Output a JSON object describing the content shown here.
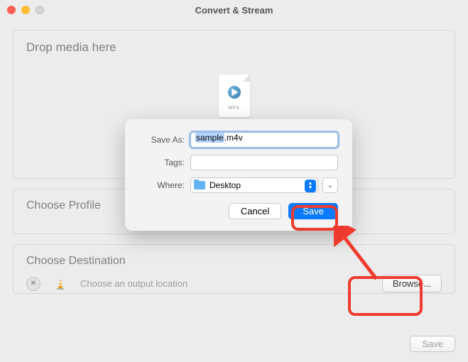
{
  "window": {
    "title": "Convert & Stream"
  },
  "drop": {
    "title": "Drop media here",
    "file_ext": "MP4"
  },
  "profile": {
    "title": "Choose Profile"
  },
  "destination": {
    "title": "Choose Destination",
    "hint": "Choose an output location",
    "browse_label": "Browse..."
  },
  "bottom": {
    "save_label": "Save"
  },
  "sheet": {
    "save_as_label": "Save As:",
    "filename_selected": "sample",
    "filename_rest": ".m4v",
    "tags_label": "Tags:",
    "tags_value": "",
    "where_label": "Where:",
    "where_value": "Desktop",
    "cancel_label": "Cancel",
    "save_label": "Save"
  },
  "colors": {
    "accent": "#0a7bff",
    "highlight": "#ef3b2f"
  }
}
